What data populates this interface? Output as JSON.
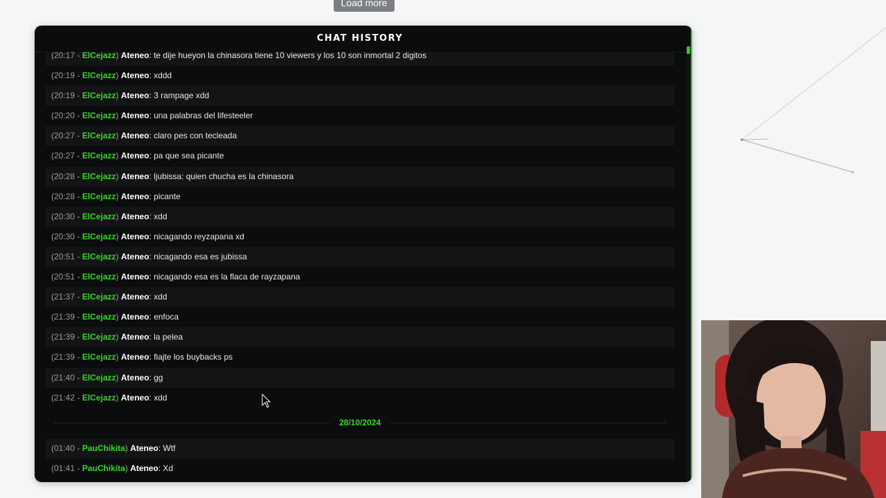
{
  "load_more_label": "Load more",
  "panel": {
    "title": "CHAT HISTORY"
  },
  "accent_color": "#38d62a",
  "messages": [
    {
      "time": "(20:17",
      "user": "ElCejazz",
      "channel": "Ateneo",
      "text": ": te dije hueyon la chinasora tiene 10 viewers y los 10 son inmortal 2 digitos"
    },
    {
      "time": "(20:19",
      "user": "ElCejazz",
      "channel": "Ateneo",
      "text": ": xddd"
    },
    {
      "time": "(20:19",
      "user": "ElCejazz",
      "channel": "Ateneo",
      "text": ": 3 rampage xdd"
    },
    {
      "time": "(20:20",
      "user": "ElCejazz",
      "channel": "Ateneo",
      "text": ": una palabras del lifesteeler"
    },
    {
      "time": "(20:27",
      "user": "ElCejazz",
      "channel": "Ateneo",
      "text": ": claro pes con tecleada"
    },
    {
      "time": "(20:27",
      "user": "ElCejazz",
      "channel": "Ateneo",
      "text": ": pa que sea picante"
    },
    {
      "time": "(20:28",
      "user": "ElCejazz",
      "channel": "Ateneo",
      "text": ": ljubissa: quien chucha es la chinasora"
    },
    {
      "time": "(20:28",
      "user": "ElCejazz",
      "channel": "Ateneo",
      "text": ": picante"
    },
    {
      "time": "(20:30",
      "user": "ElCejazz",
      "channel": "Ateneo",
      "text": ": xdd"
    },
    {
      "time": "(20:30",
      "user": "ElCejazz",
      "channel": "Ateneo",
      "text": ": nicagando reyzapana xd"
    },
    {
      "time": "(20:51",
      "user": "ElCejazz",
      "channel": "Ateneo",
      "text": ": nicagando esa es jubissa"
    },
    {
      "time": "(20:51",
      "user": "ElCejazz",
      "channel": "Ateneo",
      "text": ": nicagando esa es la flaca de rayzapana"
    },
    {
      "time": "(21:37",
      "user": "ElCejazz",
      "channel": "Ateneo",
      "text": ": xdd"
    },
    {
      "time": "(21:39",
      "user": "ElCejazz",
      "channel": "Ateneo",
      "text": ": enfoca"
    },
    {
      "time": "(21:39",
      "user": "ElCejazz",
      "channel": "Ateneo",
      "text": ": la pelea"
    },
    {
      "time": "(21:39",
      "user": "ElCejazz",
      "channel": "Ateneo",
      "text": ": fiajte los buybacks ps"
    },
    {
      "time": "(21:40",
      "user": "ElCejazz",
      "channel": "Ateneo",
      "text": ": gg"
    },
    {
      "time": "(21:42",
      "user": "ElCejazz",
      "channel": "Ateneo",
      "text": ": xdd"
    }
  ],
  "date_separator": "28/10/2024",
  "messages_after": [
    {
      "time": "(01:40",
      "user": "PauChikita",
      "channel": "Ateneo",
      "text": ": Wtf"
    },
    {
      "time": "(01:41",
      "user": "PauChikita",
      "channel": "Ateneo",
      "text": ": Xd"
    }
  ]
}
